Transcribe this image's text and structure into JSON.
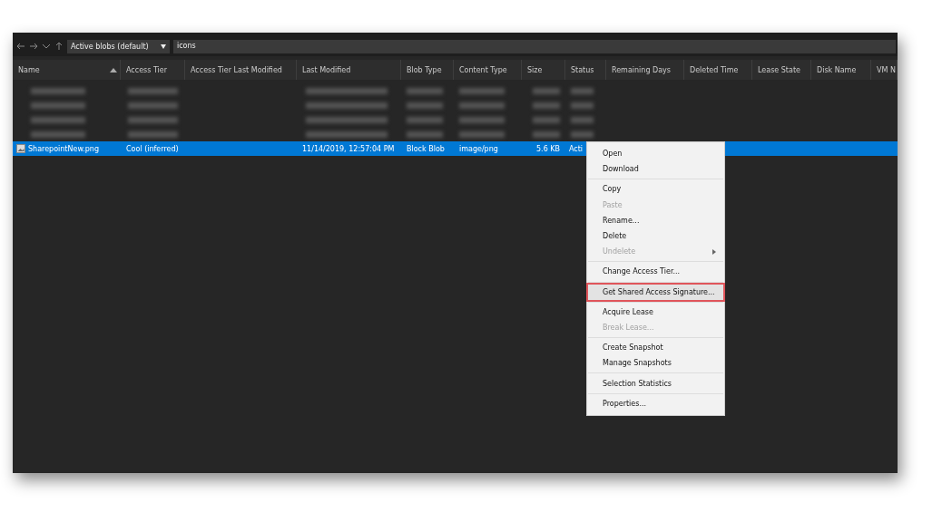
{
  "toolbar": {
    "view_select": "Active blobs (default)",
    "search": "icons"
  },
  "table": {
    "columns": [
      {
        "label": "Name",
        "sorted": true
      },
      {
        "label": "Access Tier",
        "sorted": false
      },
      {
        "label": "Access Tier Last Modified",
        "sorted": false
      },
      {
        "label": "Last Modified",
        "sorted": false
      },
      {
        "label": "Blob Type",
        "sorted": false
      },
      {
        "label": "Content Type",
        "sorted": false
      },
      {
        "label": "Size",
        "sorted": false
      },
      {
        "label": "Status",
        "sorted": false
      },
      {
        "label": "Remaining Days",
        "sorted": false
      },
      {
        "label": "Deleted Time",
        "sorted": false
      },
      {
        "label": "Lease State",
        "sorted": false
      },
      {
        "label": "Disk Name",
        "sorted": false
      },
      {
        "label": "VM N",
        "sorted": false
      }
    ],
    "rows": [
      {
        "kind": "blurred",
        "selected": false
      },
      {
        "kind": "blurred",
        "selected": false
      },
      {
        "kind": "blurred",
        "selected": false
      },
      {
        "kind": "blurred",
        "selected": false
      },
      {
        "kind": "file",
        "selected": true,
        "cells": [
          "SharepointNew.png",
          "Cool (inferred)",
          "",
          "11/14/2019, 12:57:04 PM",
          "Block Blob",
          "image/png",
          "5.6 KB",
          "Acti"
        ]
      }
    ]
  },
  "context_menu": {
    "groups": [
      [
        {
          "label": "Open",
          "disabled": false,
          "selected": false
        },
        {
          "label": "Download",
          "disabled": false,
          "selected": false
        }
      ],
      [
        {
          "label": "Copy",
          "disabled": false,
          "selected": false
        },
        {
          "label": "Paste",
          "disabled": true,
          "selected": false
        },
        {
          "label": "Rename...",
          "disabled": false,
          "selected": false
        },
        {
          "label": "Delete",
          "disabled": false,
          "selected": false
        },
        {
          "label": "Undelete",
          "disabled": true,
          "selected": false,
          "submenu": true
        }
      ],
      [
        {
          "label": "Change Access Tier...",
          "disabled": false,
          "selected": false
        }
      ],
      [
        {
          "label": "Get Shared Access Signature...",
          "disabled": false,
          "selected": true
        }
      ],
      [
        {
          "label": "Acquire Lease",
          "disabled": false,
          "selected": false
        },
        {
          "label": "Break Lease...",
          "disabled": true,
          "selected": false
        }
      ],
      [
        {
          "label": "Create Snapshot",
          "disabled": false,
          "selected": false
        },
        {
          "label": "Manage Snapshots",
          "disabled": false,
          "selected": false
        }
      ],
      [
        {
          "label": "Selection Statistics",
          "disabled": false,
          "selected": false
        }
      ],
      [
        {
          "label": "Properties...",
          "disabled": false,
          "selected": false
        }
      ]
    ]
  }
}
